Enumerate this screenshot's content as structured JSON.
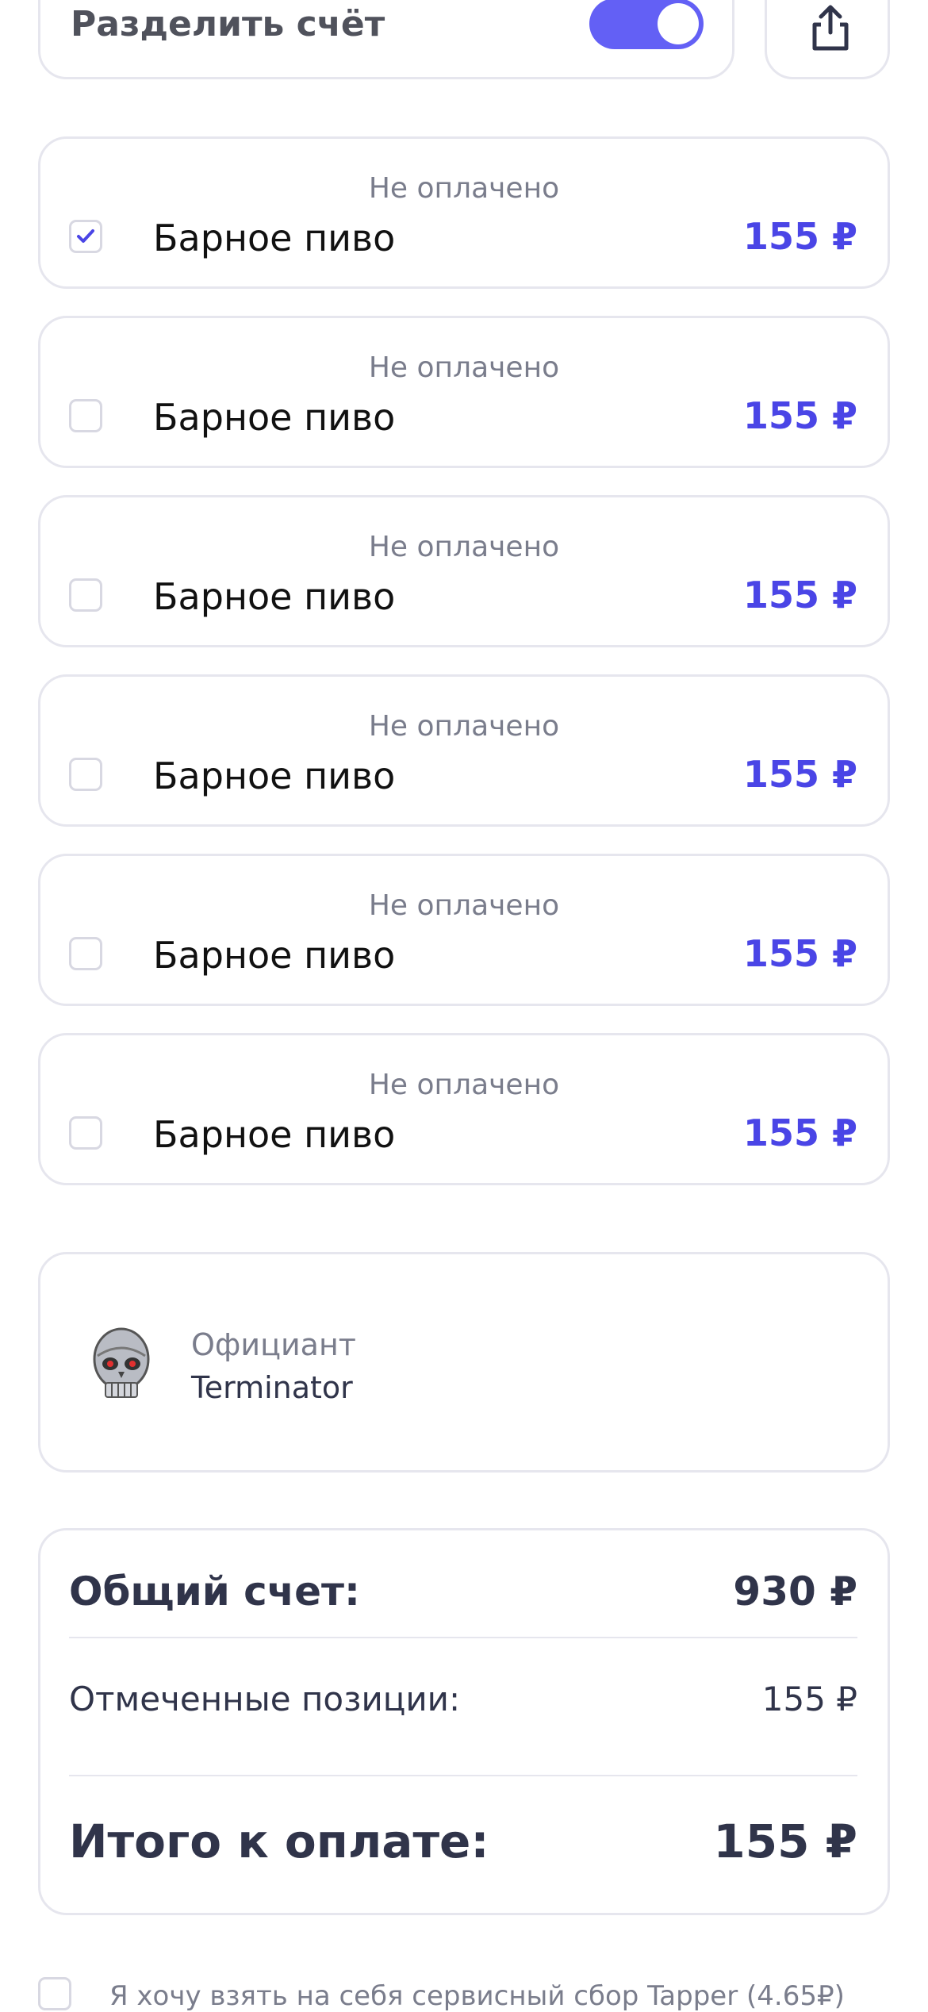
{
  "split": {
    "label": "Разделить счёт",
    "enabled": true
  },
  "share": {
    "icon": "share-icon"
  },
  "items": [
    {
      "status": "Не оплачено",
      "name": "Барное пиво",
      "price": "155 ₽",
      "checked": true
    },
    {
      "status": "Не оплачено",
      "name": "Барное пиво",
      "price": "155 ₽",
      "checked": false
    },
    {
      "status": "Не оплачено",
      "name": "Барное пиво",
      "price": "155 ₽",
      "checked": false
    },
    {
      "status": "Не оплачено",
      "name": "Барное пиво",
      "price": "155 ₽",
      "checked": false
    },
    {
      "status": "Не оплачено",
      "name": "Барное пиво",
      "price": "155 ₽",
      "checked": false
    },
    {
      "status": "Не оплачено",
      "name": "Барное пиво",
      "price": "155 ₽",
      "checked": false
    }
  ],
  "waiter": {
    "role": "Официант",
    "name": "Terminator"
  },
  "totals": {
    "total_label": "Общий счет:",
    "total_value": "930 ₽",
    "marked_label": "Отмеченные позиции:",
    "marked_value": "155 ₽",
    "pay_label": "Итого к оплате:",
    "pay_value": "155 ₽"
  },
  "fee": {
    "label": "Я хочу взять на себя сервисный сбор Tapper (4.65₽)",
    "checked": false
  },
  "colors": {
    "accent": "#4a45e6",
    "toggle": "#6360f5",
    "muted": "#7a7d8c",
    "dark": "#30344a"
  }
}
